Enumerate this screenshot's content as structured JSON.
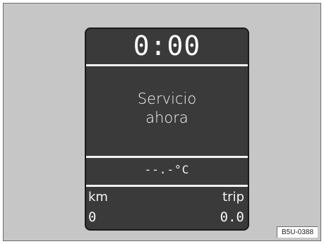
{
  "display": {
    "clock": "0:00",
    "message_line1": "Servicio",
    "message_line2": "ahora",
    "temperature": "--.-°C",
    "odometer": {
      "left_label": "km",
      "left_value": "0",
      "right_label": "trip",
      "right_value": "0.0"
    }
  },
  "figure_reference": "B5U-0388",
  "colors": {
    "background": "#c6c6c6",
    "display_bg": "#3a3a3a",
    "display_text": "#ffffff"
  }
}
